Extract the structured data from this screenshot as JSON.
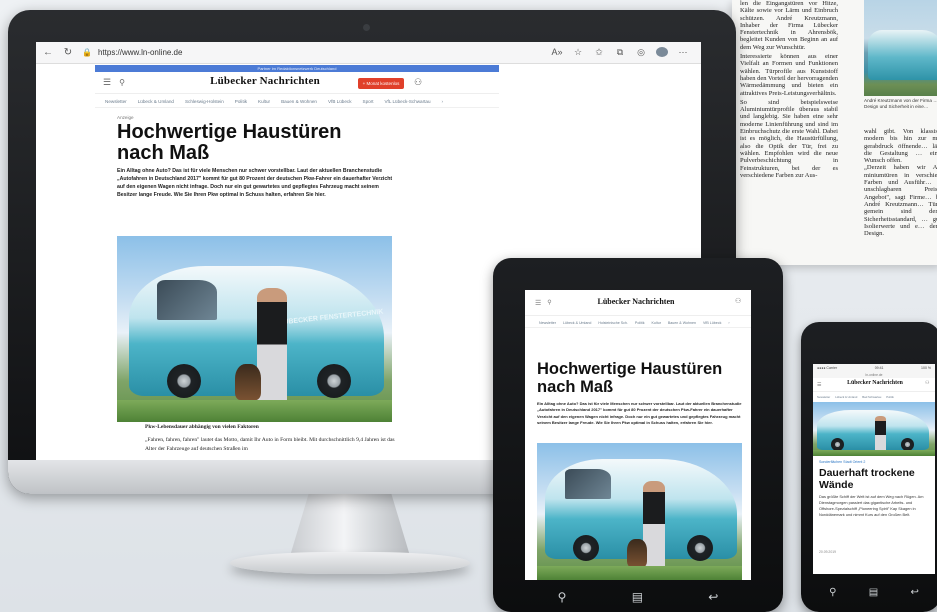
{
  "newspaper": {
    "col1": [
      "len die Eingangstüren vor Hitze, Kälte sowie vor Lärm und Einbruch schützen. André Kreutzmann, Inhaber der Firma Lübecker Fenstertechnik in Ahrensbök, begleitet Kunden von Beginn an auf dem Weg zur Wunschtür.",
      "Interessierte können aus einer Vielfalt an Formen und Funktionen wählen. Türprofile aus Kunststoff haben den Vorteil der hervorragenden Wärmedämmung und bieten ein attraktives Preis-Leistungsverhältnis.",
      "So sind beispielsweise Aluminiumtürprofile überaus stabil und langlebig. Sie haben eine sehr moderne Linienführung und sind im Einbruchschutz die erste Wahl. Dabei ist es möglich, die Haustürfüllung, also die Optik der Tür, frei zu wählen. Empfohlen wird die neue Pulverbeschichtung in Feinstrukturen, bei der es verschiedene Farben zur Aus-"
    ],
    "caption": "André Kreutzmann von der Firma … Design und Sicherheit in eine…",
    "col2": [
      "wahl gibt. Von klassisch modern bis hin zur m… gerabdruck öffnende… lässt die Gestaltung … einen Wunsch offen.",
      "„Derzeit haben wir A… miniumtüren in verschie… Farben und Ausführ… zu unschlagbaren Preis… Angebot\", sagt Firme… ber André Kreutzmann… Türen gemein sind der… Sicherheitsstandard, … gute Isolierwerte und e… derne Design."
    ]
  },
  "monitor": {
    "browser": {
      "url": "https://www.ln-online.de",
      "back": "←",
      "reload": "↻",
      "tool_icons": [
        "A»",
        "☆",
        "✩",
        "⧉",
        "◎",
        "⋯"
      ]
    },
    "blue_banner": "Partner im Redaktionsnetzwerk Deutschland",
    "site": {
      "logo": "Lübecker Nachrichten",
      "abo_button": "+ Monat kostenlos",
      "nav": [
        "Newsletter",
        "Lübeck & Umland",
        "Schleswig-Holstein",
        "Politik",
        "Kultur",
        "Bauen & Wohnen",
        "VfB Lübeck",
        "Sport",
        "VfL Lübeck-Schwartau",
        "›"
      ]
    },
    "article": {
      "kicker": "Anzeige",
      "headline": "Hochwertige Haustüren nach Maß",
      "lead": "Ein Alltag ohne Auto? Das ist für viele Menschen nur schwer vorstellbar. Laut der aktuellen Branchenstudie „Autofahren in Deutschland 2017\" kommt für gut 80 Prozent der deutschen Pkw-Fahrer ein dauerhafter Verzicht auf den eigenen Wagen nicht infrage. Doch nur ein gut gewartetes und gepflegtes Fahrzeug macht seinem Besitzer lange Freude. Wie Sie Ihren Pkw optimal in Schuss halten, erfahren Sie hier.",
      "subhead": "Pkw-Lebensdauer abhängig von vielen Faktoren",
      "body": "„Fahren, fahren, fahren\" lautet das Motto, damit Ihr Auto in Form bleibt. Mit durchschnittlich 9,4 Jahren ist das Alter der Fahrzeuge auf deutschen Straßen im",
      "van_text": "LÜBECKER FENSTERTECHNIK"
    }
  },
  "tablet": {
    "logo": "Lübecker Nachrichten",
    "nav": [
      "Newsletter",
      "Lübeck & Umland",
      "Holsteinische Sch.",
      "Politik",
      "Kultur",
      "Bauen & Wohnen",
      "VfB Lübeck",
      "›"
    ],
    "headline": "Hochwertige Haustüren nach Maß",
    "lead": "Ein Alltag ohne Auto? Das ist für viele Menschen nur schwer vorstellbar. Laut der aktuellen Branchenstudie „Autofahren in Deutschland 2017\" kommt für gut 80 Prozent der deutschen Pkw-Fahrer ein dauerhafter Verzicht auf den eigenen Wagen nicht infrage. Doch nur ein gut gewartetes und gepflegtes Fahrzeug macht seinem Besitzer lange Freude. Wie Sie Ihren Pkw optimal in Schuss halten, erfahren Sie hier."
  },
  "phone": {
    "status_left": "●●●● Carrier",
    "status_time": "09:41",
    "status_right": "100 %",
    "url": "ln-online.de",
    "logo": "Lübecker Nachrichten",
    "nav": [
      "Newsletter",
      "Lübeck & Umland",
      "Bad Schwartau",
      "Politik"
    ],
    "kicker": "Sonderflächen Stadt Orient 2",
    "headline": "Dauerhaft trockene Wände",
    "body": "Das größte Schiff der Welt ist auf dem Weg nach Rügen. Am Dienstagmorgen passiert das gigantische Arbeits- und Offshore-Spezialschiff „Pioneering Spirit\" Kap Skagen in Norddänemark und nimmt Kurs auf den Großen Belt.",
    "date": "20.09.2019"
  }
}
